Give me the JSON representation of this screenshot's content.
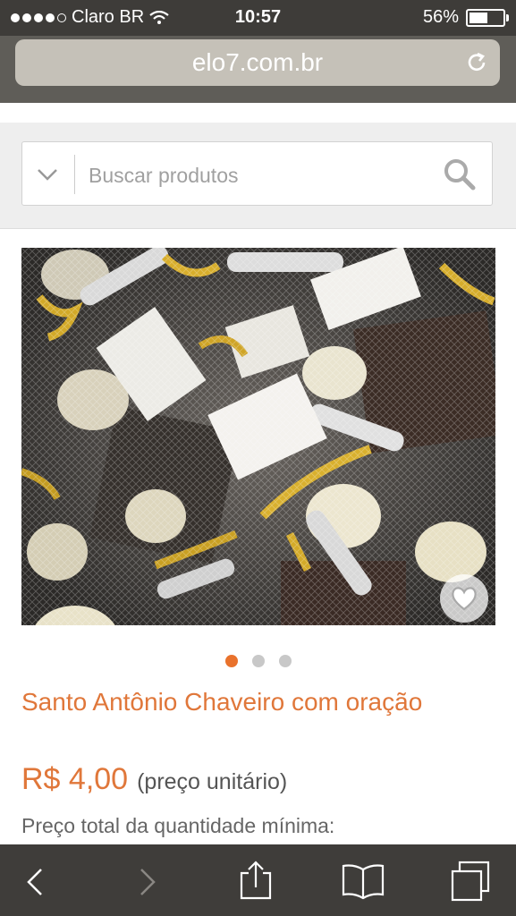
{
  "status_bar": {
    "carrier": "Claro BR",
    "time": "10:57",
    "battery": "56%",
    "battery_level": 0.56,
    "signal_bars": 4,
    "signal_total": 5
  },
  "browser": {
    "url": "elo7.com.br"
  },
  "search": {
    "placeholder": "Buscar produtos"
  },
  "product": {
    "image_icon": "product-photo",
    "favorite_icon": "heart-icon",
    "carousel": {
      "count": 3,
      "active": 0
    },
    "title": "Santo Antônio Chaveiro com oração",
    "price": "R$ 4,00",
    "price_note": "(preço unitário)",
    "min_quantity_label": "Preço total da quantidade mínima:"
  },
  "toolbar": {
    "icons": [
      "back-icon",
      "forward-icon",
      "share-icon",
      "bookmarks-icon",
      "tabs-icon"
    ]
  },
  "colors": {
    "accent": "#e0773a",
    "status_bar": "#3e3c39",
    "toolbar": "#3f3d3a",
    "carousel_inactive": "#c8c8c8"
  }
}
